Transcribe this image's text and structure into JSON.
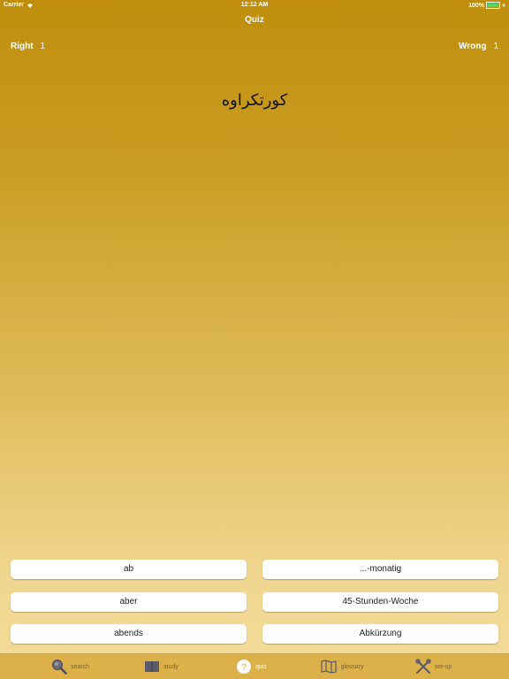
{
  "status": {
    "carrier": "Carrier",
    "time": "12:12 AM",
    "battery": "100%"
  },
  "nav": {
    "title": "Quiz"
  },
  "score": {
    "right_label": "Right",
    "right_count": "1",
    "wrong_label": "Wrong",
    "wrong_count": "1"
  },
  "question": {
    "text": "کورتکراوه"
  },
  "answers": [
    "ab",
    "...-monatig",
    "aber",
    "45-Stunden-Woche",
    "abends",
    "Abkürzung"
  ],
  "tabs": [
    {
      "label": "search",
      "icon": "magnifier-icon"
    },
    {
      "label": "study",
      "icon": "book-icon"
    },
    {
      "label": "quiz",
      "icon": "question-circle-icon"
    },
    {
      "label": "glossary",
      "icon": "map-icon"
    },
    {
      "label": "set-up",
      "icon": "tools-icon"
    }
  ],
  "colors": {
    "accent": "#c08e0c",
    "tab_bar": "#ddb14a",
    "tab_inactive": "#7a6030",
    "tab_active": "#ffffff"
  }
}
